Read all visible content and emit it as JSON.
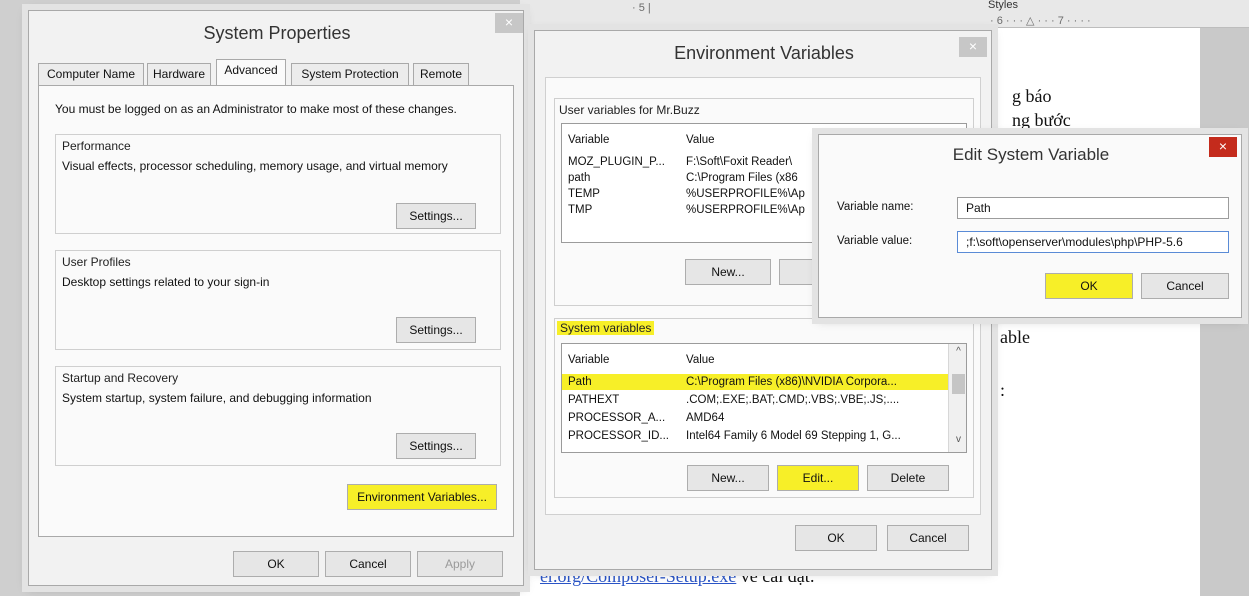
{
  "background": {
    "styles_label": "Styles",
    "ruler_left": "· 5 |",
    "ruler_right": "· 6 · · · △ · · · 7 · · · ·",
    "text_1": "g báo",
    "text_2": "ng bước",
    "text_3": "able",
    "text_4": ":",
    "footer_link": "er.org/Composer-Setup.exe",
    "footer_rest": "về cài đặt:"
  },
  "system_properties": {
    "title": "System Properties",
    "close": "×",
    "tabs": [
      {
        "label": "Computer Name",
        "active": false
      },
      {
        "label": "Hardware",
        "active": false
      },
      {
        "label": "Advanced",
        "active": true
      },
      {
        "label": "System Protection",
        "active": false
      },
      {
        "label": "Remote",
        "active": false
      }
    ],
    "admin_notice": "You must be logged on as an Administrator to make most of these changes.",
    "performance": {
      "label": "Performance",
      "desc": "Visual effects, processor scheduling, memory usage, and virtual memory",
      "button": "Settings..."
    },
    "user_profiles": {
      "label": "User Profiles",
      "desc": "Desktop settings related to your sign-in",
      "button": "Settings..."
    },
    "startup": {
      "label": "Startup and Recovery",
      "desc": "System startup, system failure, and debugging information",
      "button": "Settings..."
    },
    "env_button": "Environment Variables...",
    "ok": "OK",
    "cancel": "Cancel",
    "apply": "Apply"
  },
  "environment_variables": {
    "title": "Environment Variables",
    "close": "×",
    "user_label": "User variables for Mr.Buzz",
    "user_headers": [
      "Variable",
      "Value"
    ],
    "user_rows": [
      {
        "name": "MOZ_PLUGIN_P...",
        "value": "F:\\Soft\\Foxit Reader\\"
      },
      {
        "name": "path",
        "value": "C:\\Program Files (x86"
      },
      {
        "name": "TEMP",
        "value": "%USERPROFILE%\\Ap"
      },
      {
        "name": "TMP",
        "value": "%USERPROFILE%\\Ap"
      }
    ],
    "user_new": "New...",
    "user_edit": "Ed",
    "system_label": "System variables",
    "system_headers": [
      "Variable",
      "Value"
    ],
    "system_rows": [
      {
        "name": "Path",
        "value": "C:\\Program Files (x86)\\NVIDIA Corpora...",
        "highlight": true
      },
      {
        "name": "PATHEXT",
        "value": ".COM;.EXE;.BAT;.CMD;.VBS;.VBE;.JS;....",
        "highlight": false
      },
      {
        "name": "PROCESSOR_A...",
        "value": "AMD64",
        "highlight": false
      },
      {
        "name": "PROCESSOR_ID...",
        "value": "Intel64 Family 6 Model 69 Stepping 1, G...",
        "highlight": false
      }
    ],
    "sys_new": "New...",
    "sys_edit": "Edit...",
    "sys_delete": "Delete",
    "ok": "OK",
    "cancel": "Cancel",
    "scroll_up": "^",
    "scroll_down": "v"
  },
  "edit_system_variable": {
    "title": "Edit System Variable",
    "close": "×",
    "name_label": "Variable name:",
    "name_value": "Path",
    "value_label": "Variable value:",
    "value_value": ";f:\\soft\\openserver\\modules\\php\\PHP-5.6",
    "ok": "OK",
    "cancel": "Cancel"
  },
  "colors": {
    "highlight": "#f7ef28",
    "close_red": "#c42b1c"
  }
}
